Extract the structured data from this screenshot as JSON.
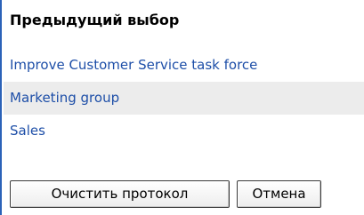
{
  "panel": {
    "title": "Предыдущий выбор",
    "items": [
      {
        "label": "Improve Customer Service task force"
      },
      {
        "label": "Marketing group"
      },
      {
        "label": "Sales"
      }
    ]
  },
  "actions": {
    "clear_label": "Очистить протокол",
    "cancel_label": "Отмена"
  },
  "colors": {
    "link": "#1e4fa8",
    "accent_border": "#2b62b8",
    "row_highlight": "#ececec"
  }
}
